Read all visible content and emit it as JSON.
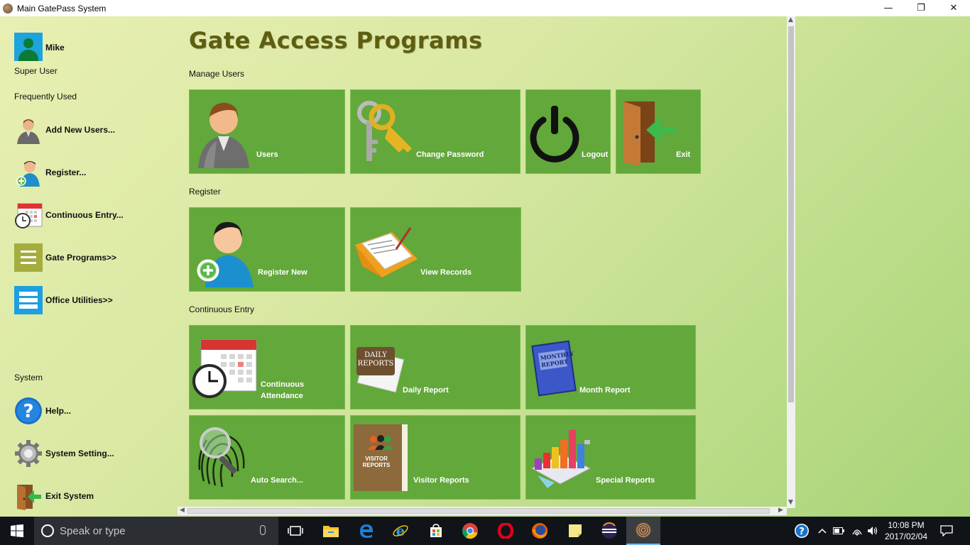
{
  "window": {
    "title": "Main GatePass System",
    "minimize": "—",
    "maximize": "❐",
    "close": "✕"
  },
  "sidebar": {
    "user_name": "Mike",
    "user_role": "Super User",
    "frequently_used_label": "Frequently Used",
    "items": [
      {
        "label": "Add New Users..."
      },
      {
        "label": "Register..."
      },
      {
        "label": "Continuous Entry..."
      },
      {
        "label": "Gate Programs>>"
      },
      {
        "label": "Office Utilities>>"
      }
    ],
    "system_label": "System",
    "system_items": [
      {
        "label": "Help..."
      },
      {
        "label": "System Setting..."
      },
      {
        "label": "Exit System"
      }
    ]
  },
  "main": {
    "title": "Gate Access Programs",
    "groups": [
      {
        "label": "Manage Users",
        "tiles": [
          {
            "label": "Users"
          },
          {
            "label": "Change Password"
          },
          {
            "label": "Logout"
          },
          {
            "label": "Exit"
          }
        ]
      },
      {
        "label": "Register",
        "tiles": [
          {
            "label": "Register New"
          },
          {
            "label": "View Records"
          }
        ]
      },
      {
        "label": "Continuous Entry",
        "tiles": [
          {
            "label": "Continuous Attendance"
          },
          {
            "label": "Daily Report"
          },
          {
            "label": "Month Report"
          },
          {
            "label": "Auto Search..."
          },
          {
            "label": "Visitor Reports"
          },
          {
            "label": "Special Reports"
          }
        ]
      }
    ],
    "tile_texts": {
      "daily_reports": "DAILY REPORTS",
      "monthly_report": "MONTHLY REPORT",
      "visitor_reports": "VISITOR REPORTS"
    }
  },
  "taskbar": {
    "search_placeholder": "Speak or type",
    "time": "10:08 PM",
    "date": "2017/02/04"
  },
  "colors": {
    "tile": "#62a83a",
    "title": "#5e5e10",
    "accent_blue": "#1ca4dc"
  }
}
